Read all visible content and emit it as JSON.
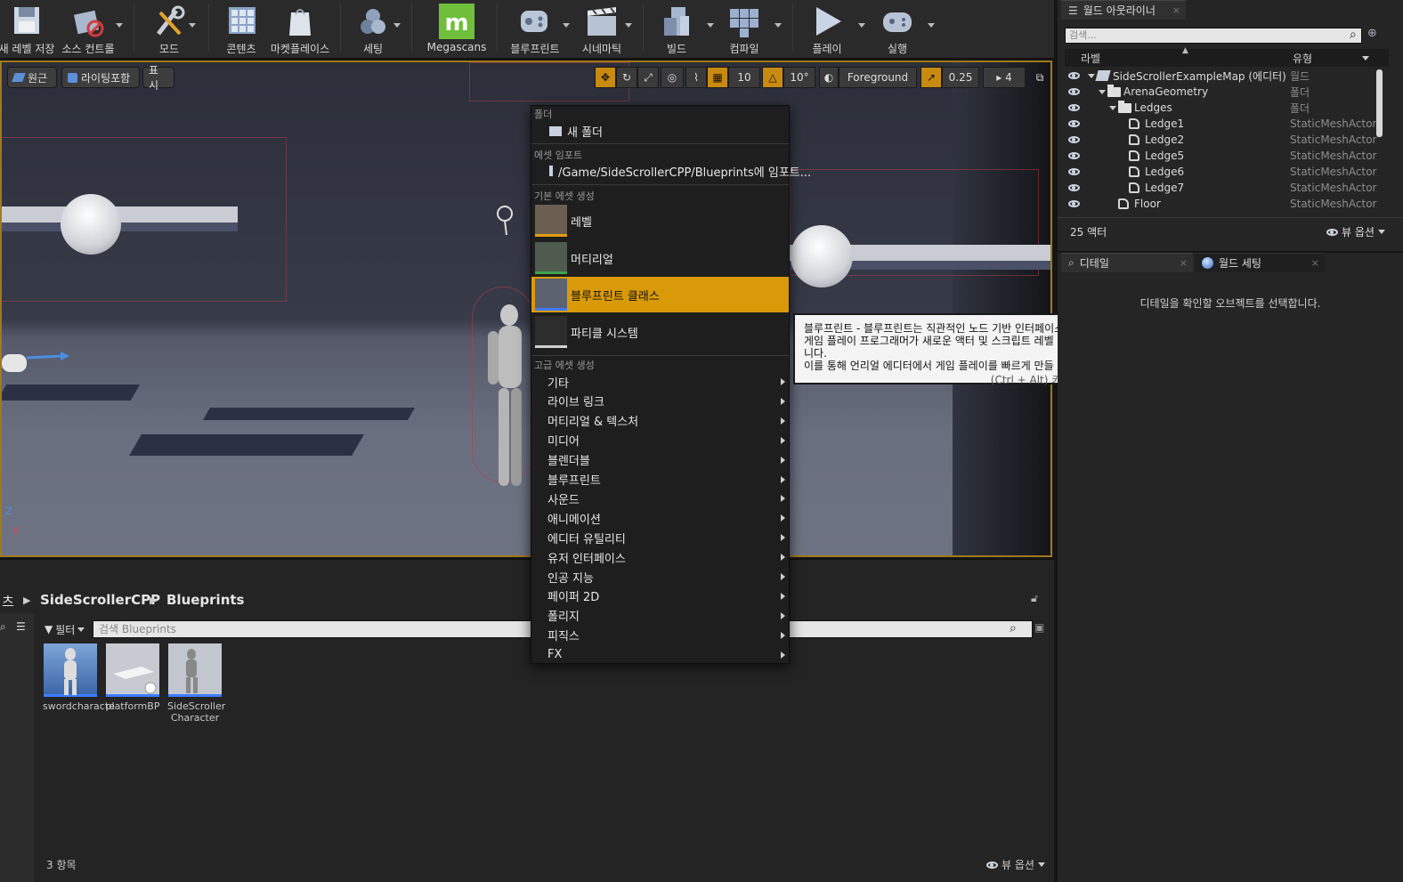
{
  "toolbar": {
    "buttons": [
      {
        "label": "새 레벨 저장",
        "icon": "save-icon"
      },
      {
        "label": "소스 컨트롤",
        "icon": "source-control-icon"
      },
      {
        "label": "모드",
        "icon": "modes-icon"
      },
      {
        "label": "콘텐츠",
        "icon": "content-icon"
      },
      {
        "label": "마켓플레이스",
        "icon": "marketplace-icon"
      },
      {
        "label": "세팅",
        "icon": "settings-icon"
      },
      {
        "label": "Megascans",
        "icon": "megascans-icon"
      },
      {
        "label": "블루프린트",
        "icon": "blueprints-icon"
      },
      {
        "label": "시네마틱",
        "icon": "cinematics-icon"
      },
      {
        "label": "빌드",
        "icon": "build-icon"
      },
      {
        "label": "컴파일",
        "icon": "compile-icon"
      },
      {
        "label": "플레이",
        "icon": "play-icon"
      },
      {
        "label": "실행",
        "icon": "launch-icon"
      }
    ]
  },
  "viewport": {
    "view_mode": "원근",
    "lighting_mode": "라이팅포함",
    "show_label": "표시",
    "grid_snap": "10",
    "rotation_snap": "10°",
    "layer": "Foreground",
    "scale_snap": "0.25",
    "camera_speed": "4",
    "axis_z": "Z",
    "axis_x": "X"
  },
  "context_menu": {
    "folder_section": "폴더",
    "new_folder": "새 폴더",
    "import_section": "에셋 임포트",
    "import_path": "/Game/SideScrollerCPP/Blueprints에 임포트...",
    "basic_section": "기본 에셋 생성",
    "basic_items": [
      "레벨",
      "머티리얼",
      "블루프린트 클래스",
      "파티클 시스템"
    ],
    "advanced_section": "고급 에셋 생성",
    "advanced_items": [
      "기타",
      "라이브 링크",
      "머티리얼 & 텍스처",
      "미디어",
      "블렌더블",
      "블루프린트",
      "사운드",
      "애니메이션",
      "에디터 유틸리티",
      "유저 인터페이스",
      "인공 지능",
      "페이퍼 2D",
      "폴리지",
      "피직스",
      "FX"
    ],
    "highlight_color": "#d99a0a"
  },
  "tooltip": {
    "line1": "블루프린트 - 블루프린트는 직관적인 노드 기반 인터페이스를 통해, 코드를 한 줄도 작성하지 않고도 디자이너와",
    "line2": "게임 플레이 프로그래머가 새로운 액터 및 스크립트 레벨 이벤트를 쉽게 만들고 수정할 수 있게 해주는 특별한 에셋입니다.",
    "line3": "이를 통해 언리얼 에디터에서 게임 플레이를 빠르게 만들 수 있습니다.",
    "hint": "(Ctrl + Alt) 키를 누르면 상세히"
  },
  "outliner": {
    "tab_title": "월드 아웃라이너",
    "search_placeholder": "검색...",
    "col_label": "라벨",
    "col_type": "유형",
    "rows": [
      {
        "label": "SideScrollerExampleMap (에디터)",
        "type": "월드"
      },
      {
        "label": "ArenaGeometry",
        "type": "폴더"
      },
      {
        "label": "Ledges",
        "type": "폴더"
      },
      {
        "label": "Ledge1",
        "type": "StaticMeshActor"
      },
      {
        "label": "Ledge2",
        "type": "StaticMeshActor"
      },
      {
        "label": "Ledge5",
        "type": "StaticMeshActor"
      },
      {
        "label": "Ledge6",
        "type": "StaticMeshActor"
      },
      {
        "label": "Ledge7",
        "type": "StaticMeshActor"
      },
      {
        "label": "Floor",
        "type": "StaticMeshActor"
      }
    ],
    "actor_count": "25 액터",
    "view_options": "뷰 옵션"
  },
  "details": {
    "tab_details": "디테일",
    "tab_world_settings": "월드 세팅",
    "empty_message": "디테일을 확인할 오브젝트를 선택합니다."
  },
  "content_browser": {
    "path_root": "츠",
    "path_1": "SideScrollerCPP",
    "path_2": "Blueprints",
    "filter_label": "필터",
    "search_placeholder": "검색 Blueprints",
    "assets": [
      {
        "name": "swordcharacte"
      },
      {
        "name": "platformBP"
      },
      {
        "name": "SideScroller Character"
      }
    ],
    "item_count": "3 항목",
    "view_options": "뷰 옵션"
  }
}
